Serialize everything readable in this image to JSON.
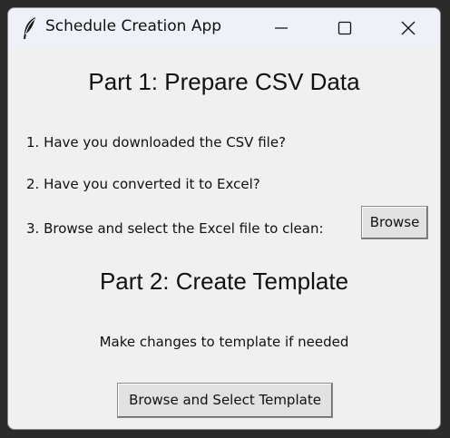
{
  "window": {
    "title": "Schedule Creation App",
    "icon": "feather-icon",
    "controls": [
      "minimize-icon",
      "maximize-icon",
      "close-icon"
    ]
  },
  "part1": {
    "heading": "Part 1: Prepare CSV Data",
    "question1": "1. Have you downloaded the CSV file?",
    "question2": "2. Have you converted it to Excel?",
    "question3": "3. Browse and select the Excel file to clean:",
    "browse_label": "Browse"
  },
  "part2": {
    "heading": "Part 2: Create Template",
    "note": "Make changes to template if needed",
    "template_button_label": "Browse and Select Template"
  }
}
